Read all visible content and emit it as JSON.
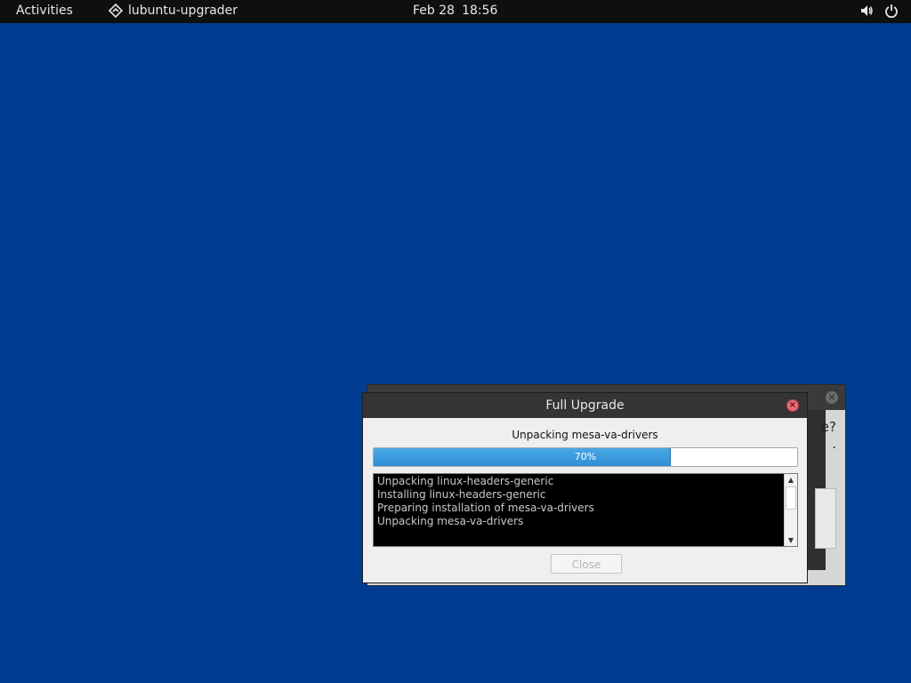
{
  "topbar": {
    "activities": "Activities",
    "app_name": "lubuntu-upgrader",
    "app_icon": "upgrader-icon",
    "date": "Feb 28",
    "time": "18:56",
    "volume_icon": "volume-icon",
    "power_icon": "power-icon"
  },
  "background_window": {
    "text_line1": "e?",
    "text_line2": "."
  },
  "dialog": {
    "title": "Full Upgrade",
    "status": "Unpacking mesa-va-drivers",
    "progress": {
      "value": 70,
      "label": "70%"
    },
    "log": [
      "Unpacking linux-headers-generic",
      "Installing linux-headers-generic",
      "Preparing installation of mesa-va-drivers",
      "Unpacking mesa-va-drivers"
    ],
    "close_button": "Close",
    "close_button_enabled": false
  },
  "colors": {
    "desktop": "#003c8f",
    "progress_fill": "#3a9ade",
    "titlebar": "#343434"
  }
}
